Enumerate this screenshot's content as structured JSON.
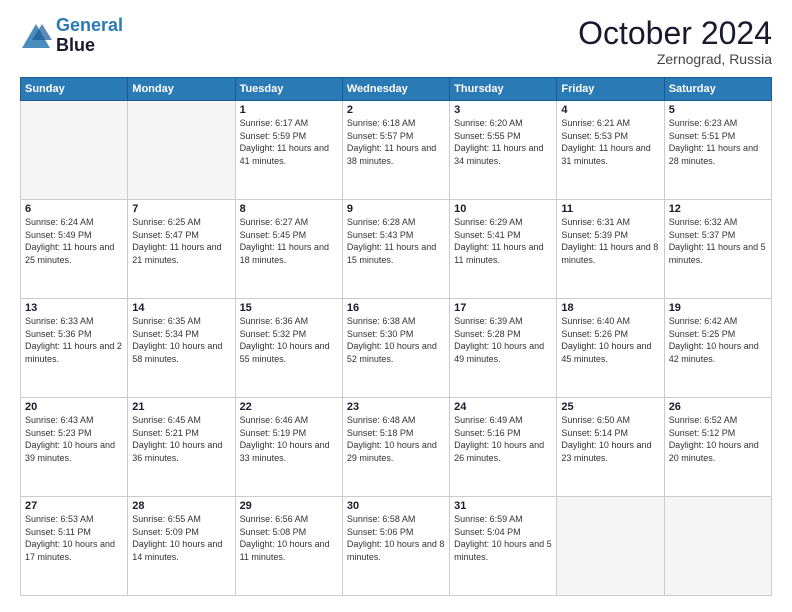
{
  "header": {
    "logo_line1": "General",
    "logo_line2": "Blue",
    "month": "October 2024",
    "location": "Zernograd, Russia"
  },
  "weekdays": [
    "Sunday",
    "Monday",
    "Tuesday",
    "Wednesday",
    "Thursday",
    "Friday",
    "Saturday"
  ],
  "weeks": [
    [
      {
        "day": "",
        "empty": true
      },
      {
        "day": "",
        "empty": true
      },
      {
        "day": "1",
        "sunrise": "Sunrise: 6:17 AM",
        "sunset": "Sunset: 5:59 PM",
        "daylight": "Daylight: 11 hours and 41 minutes."
      },
      {
        "day": "2",
        "sunrise": "Sunrise: 6:18 AM",
        "sunset": "Sunset: 5:57 PM",
        "daylight": "Daylight: 11 hours and 38 minutes."
      },
      {
        "day": "3",
        "sunrise": "Sunrise: 6:20 AM",
        "sunset": "Sunset: 5:55 PM",
        "daylight": "Daylight: 11 hours and 34 minutes."
      },
      {
        "day": "4",
        "sunrise": "Sunrise: 6:21 AM",
        "sunset": "Sunset: 5:53 PM",
        "daylight": "Daylight: 11 hours and 31 minutes."
      },
      {
        "day": "5",
        "sunrise": "Sunrise: 6:23 AM",
        "sunset": "Sunset: 5:51 PM",
        "daylight": "Daylight: 11 hours and 28 minutes."
      }
    ],
    [
      {
        "day": "6",
        "sunrise": "Sunrise: 6:24 AM",
        "sunset": "Sunset: 5:49 PM",
        "daylight": "Daylight: 11 hours and 25 minutes."
      },
      {
        "day": "7",
        "sunrise": "Sunrise: 6:25 AM",
        "sunset": "Sunset: 5:47 PM",
        "daylight": "Daylight: 11 hours and 21 minutes."
      },
      {
        "day": "8",
        "sunrise": "Sunrise: 6:27 AM",
        "sunset": "Sunset: 5:45 PM",
        "daylight": "Daylight: 11 hours and 18 minutes."
      },
      {
        "day": "9",
        "sunrise": "Sunrise: 6:28 AM",
        "sunset": "Sunset: 5:43 PM",
        "daylight": "Daylight: 11 hours and 15 minutes."
      },
      {
        "day": "10",
        "sunrise": "Sunrise: 6:29 AM",
        "sunset": "Sunset: 5:41 PM",
        "daylight": "Daylight: 11 hours and 11 minutes."
      },
      {
        "day": "11",
        "sunrise": "Sunrise: 6:31 AM",
        "sunset": "Sunset: 5:39 PM",
        "daylight": "Daylight: 11 hours and 8 minutes."
      },
      {
        "day": "12",
        "sunrise": "Sunrise: 6:32 AM",
        "sunset": "Sunset: 5:37 PM",
        "daylight": "Daylight: 11 hours and 5 minutes."
      }
    ],
    [
      {
        "day": "13",
        "sunrise": "Sunrise: 6:33 AM",
        "sunset": "Sunset: 5:36 PM",
        "daylight": "Daylight: 11 hours and 2 minutes."
      },
      {
        "day": "14",
        "sunrise": "Sunrise: 6:35 AM",
        "sunset": "Sunset: 5:34 PM",
        "daylight": "Daylight: 10 hours and 58 minutes."
      },
      {
        "day": "15",
        "sunrise": "Sunrise: 6:36 AM",
        "sunset": "Sunset: 5:32 PM",
        "daylight": "Daylight: 10 hours and 55 minutes."
      },
      {
        "day": "16",
        "sunrise": "Sunrise: 6:38 AM",
        "sunset": "Sunset: 5:30 PM",
        "daylight": "Daylight: 10 hours and 52 minutes."
      },
      {
        "day": "17",
        "sunrise": "Sunrise: 6:39 AM",
        "sunset": "Sunset: 5:28 PM",
        "daylight": "Daylight: 10 hours and 49 minutes."
      },
      {
        "day": "18",
        "sunrise": "Sunrise: 6:40 AM",
        "sunset": "Sunset: 5:26 PM",
        "daylight": "Daylight: 10 hours and 45 minutes."
      },
      {
        "day": "19",
        "sunrise": "Sunrise: 6:42 AM",
        "sunset": "Sunset: 5:25 PM",
        "daylight": "Daylight: 10 hours and 42 minutes."
      }
    ],
    [
      {
        "day": "20",
        "sunrise": "Sunrise: 6:43 AM",
        "sunset": "Sunset: 5:23 PM",
        "daylight": "Daylight: 10 hours and 39 minutes."
      },
      {
        "day": "21",
        "sunrise": "Sunrise: 6:45 AM",
        "sunset": "Sunset: 5:21 PM",
        "daylight": "Daylight: 10 hours and 36 minutes."
      },
      {
        "day": "22",
        "sunrise": "Sunrise: 6:46 AM",
        "sunset": "Sunset: 5:19 PM",
        "daylight": "Daylight: 10 hours and 33 minutes."
      },
      {
        "day": "23",
        "sunrise": "Sunrise: 6:48 AM",
        "sunset": "Sunset: 5:18 PM",
        "daylight": "Daylight: 10 hours and 29 minutes."
      },
      {
        "day": "24",
        "sunrise": "Sunrise: 6:49 AM",
        "sunset": "Sunset: 5:16 PM",
        "daylight": "Daylight: 10 hours and 26 minutes."
      },
      {
        "day": "25",
        "sunrise": "Sunrise: 6:50 AM",
        "sunset": "Sunset: 5:14 PM",
        "daylight": "Daylight: 10 hours and 23 minutes."
      },
      {
        "day": "26",
        "sunrise": "Sunrise: 6:52 AM",
        "sunset": "Sunset: 5:12 PM",
        "daylight": "Daylight: 10 hours and 20 minutes."
      }
    ],
    [
      {
        "day": "27",
        "sunrise": "Sunrise: 6:53 AM",
        "sunset": "Sunset: 5:11 PM",
        "daylight": "Daylight: 10 hours and 17 minutes."
      },
      {
        "day": "28",
        "sunrise": "Sunrise: 6:55 AM",
        "sunset": "Sunset: 5:09 PM",
        "daylight": "Daylight: 10 hours and 14 minutes."
      },
      {
        "day": "29",
        "sunrise": "Sunrise: 6:56 AM",
        "sunset": "Sunset: 5:08 PM",
        "daylight": "Daylight: 10 hours and 11 minutes."
      },
      {
        "day": "30",
        "sunrise": "Sunrise: 6:58 AM",
        "sunset": "Sunset: 5:06 PM",
        "daylight": "Daylight: 10 hours and 8 minutes."
      },
      {
        "day": "31",
        "sunrise": "Sunrise: 6:59 AM",
        "sunset": "Sunset: 5:04 PM",
        "daylight": "Daylight: 10 hours and 5 minutes."
      },
      {
        "day": "",
        "empty": true
      },
      {
        "day": "",
        "empty": true
      }
    ]
  ]
}
